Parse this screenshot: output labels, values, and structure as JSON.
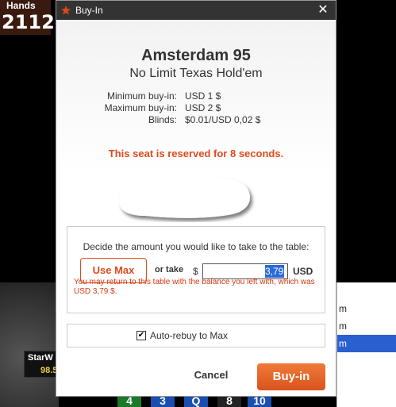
{
  "background": {
    "hands_label": "Hands",
    "hands_value": "2112",
    "menu_items": [
      "m",
      "m",
      "m"
    ],
    "menu_selected_index": 2,
    "player_name": "StarW",
    "player_stack": "98.5",
    "cards": [
      "4",
      "3",
      "Q",
      "8",
      "10"
    ],
    "card_colors": [
      "#1a7a2a",
      "#1a4fb0",
      "#1a4fb0",
      "#222222",
      "#1a4fb0"
    ]
  },
  "dialog": {
    "title": "Buy-In",
    "close_glyph": "✕",
    "table_name": "Amsterdam 95",
    "game_type": "No Limit Texas Hold'em",
    "info": [
      {
        "label": "Minimum buy-in:",
        "value": "USD 1 $"
      },
      {
        "label": "Maximum buy-in:",
        "value": "USD 2 $"
      },
      {
        "label": "Blinds:",
        "value": "$0.01/USD 0,02 $"
      }
    ],
    "reserved_text": "This seat is reserved for 8 seconds.",
    "amount_prompt": "Decide the amount you would like to take to the table:",
    "use_max_label": "Use Max",
    "or_take_label": "or take",
    "currency_symbol": "$",
    "amount_value": "3,79",
    "currency_code": "USD",
    "return_note": "You may return to this table with the balance you left with, which was USD 3,79 $.",
    "auto_rebuy_label": "Auto-rebuy to Max",
    "auto_rebuy_checked": "✔",
    "cancel_label": "Cancel",
    "buyin_label": "Buy-in"
  },
  "colors": {
    "accent": "#e04a1a",
    "titlebar": "#333333",
    "selection": "#2a6ad9"
  }
}
